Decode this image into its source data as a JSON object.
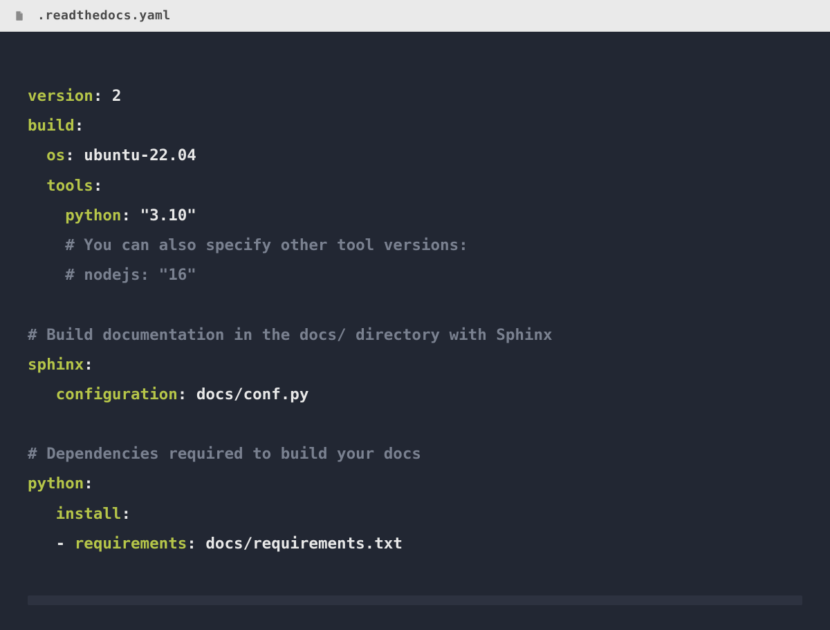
{
  "header": {
    "filename": ".readthedocs.yaml"
  },
  "code": {
    "version_key": "version",
    "version_val": "2",
    "build_key": "build",
    "os_key": "os",
    "os_val": "ubuntu-22.04",
    "tools_key": "tools",
    "python_tool_key": "python",
    "python_tool_val": "\"3.10\"",
    "comment_tool1": "# You can also specify other tool versions:",
    "comment_tool2": "# nodejs: \"16\"",
    "comment_sphinx": "# Build documentation in the docs/ directory with Sphinx",
    "sphinx_key": "sphinx",
    "configuration_key": "configuration",
    "configuration_val": "docs/conf.py",
    "comment_deps": "# Dependencies required to build your docs",
    "python_key": "python",
    "install_key": "install",
    "dash": "-",
    "requirements_key": "requirements",
    "requirements_val": "docs/requirements.txt"
  }
}
